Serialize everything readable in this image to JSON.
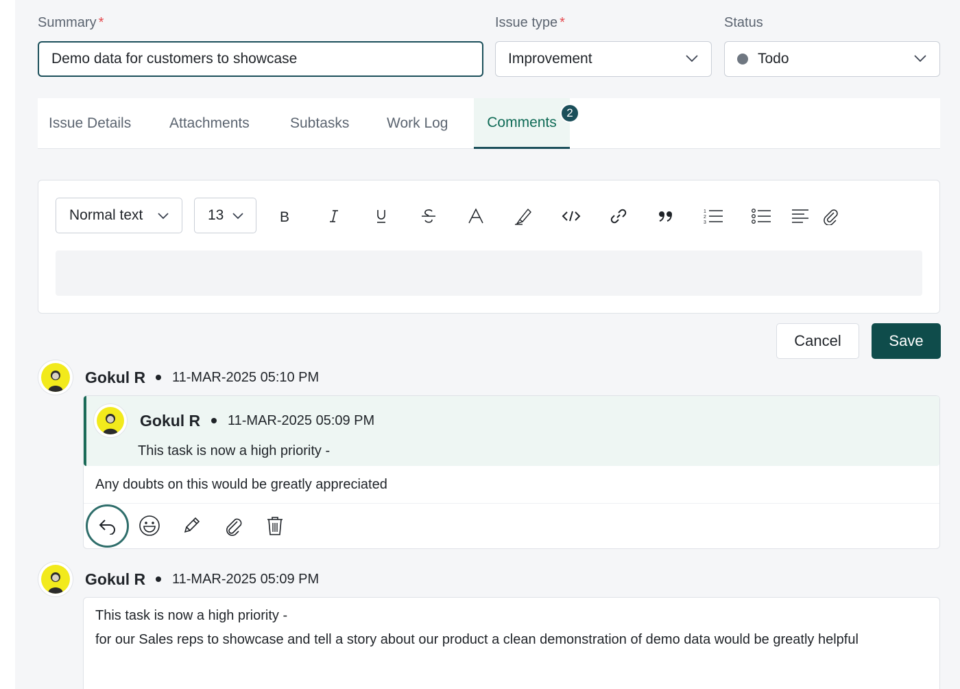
{
  "form": {
    "summary": {
      "label": "Summary",
      "required_mark": "*",
      "value": "Demo data for customers to showcase"
    },
    "issue_type": {
      "label": "Issue type",
      "required_mark": "*",
      "value": "Improvement"
    },
    "status": {
      "label": "Status",
      "value": "Todo",
      "dot_color": "#6f7781"
    }
  },
  "tabs": [
    {
      "label": "Issue Details"
    },
    {
      "label": "Attachments"
    },
    {
      "label": "Subtasks"
    },
    {
      "label": "Work Log"
    },
    {
      "label": "Comments",
      "badge": "2",
      "active": true
    }
  ],
  "editor": {
    "text_style": "Normal text",
    "font_size": "13",
    "tools": [
      "bold-icon",
      "italic-icon",
      "underline-icon",
      "strikethrough-icon",
      "text-color-icon",
      "highlight-icon",
      "code-icon",
      "link-icon",
      "quote-icon",
      "ordered-list-icon",
      "bullet-list-icon",
      "align-left-icon",
      "attach-icon"
    ]
  },
  "actions": {
    "cancel": "Cancel",
    "save": "Save"
  },
  "comments": [
    {
      "author": "Gokul R",
      "time": "11-MAR-2025 05:10 PM",
      "quoted": {
        "author": "Gokul R",
        "time": "11-MAR-2025 05:09 PM",
        "text": "This task is now a high priority -"
      },
      "body": "Any doubts on this would be greatly appreciated",
      "actions": [
        "reply-icon",
        "emoji-icon",
        "edit-icon",
        "attach-icon",
        "delete-icon"
      ]
    },
    {
      "author": "Gokul R",
      "time": "11-MAR-2025 05:09 PM",
      "body_lines": [
        "This task is now a high priority -",
        "for our Sales reps to showcase and tell a story about our product a clean demonstration of demo data would be greatly helpful"
      ]
    }
  ],
  "colors": {
    "accent": "#1b4f5a",
    "save_button": "#0f4c4b",
    "active_tab_text": "#0e6a55",
    "required": "#e5484d",
    "avatar_bg": "#f2ea1c"
  }
}
